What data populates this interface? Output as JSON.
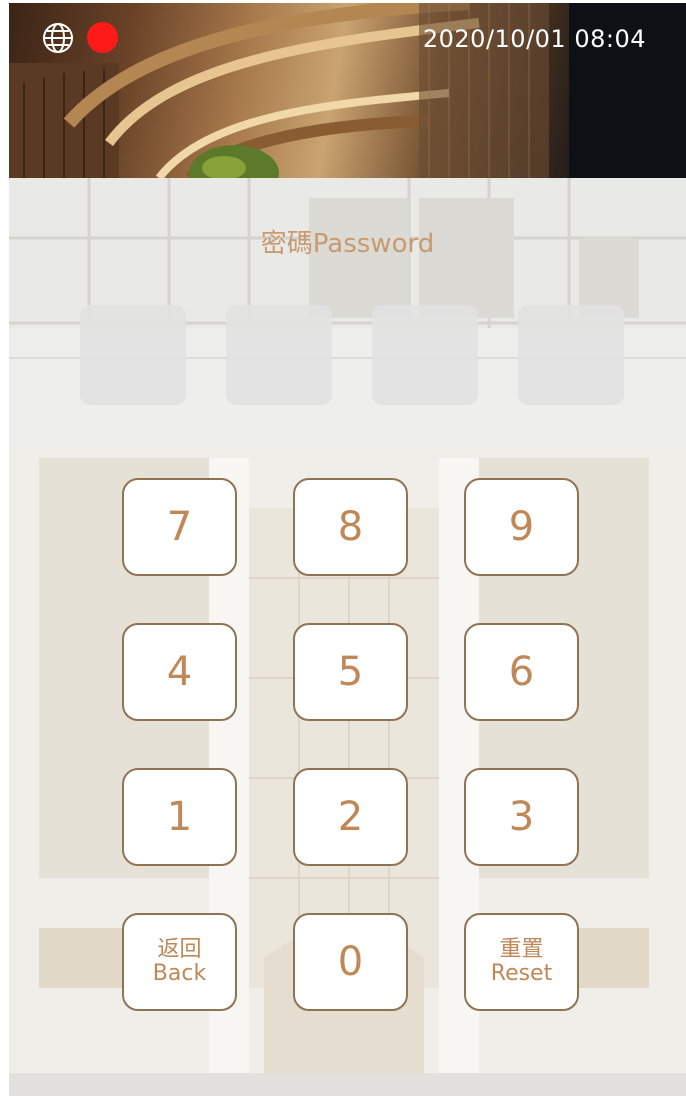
{
  "status": {
    "datetime": "2020/10/01  08:04",
    "network_icon": "globe-icon",
    "recording_color": "#ff1a1a"
  },
  "password": {
    "label": "密碼Password",
    "slots": [
      "",
      "",
      "",
      ""
    ]
  },
  "keypad": {
    "k7": "7",
    "k8": "8",
    "k9": "9",
    "k4": "4",
    "k5": "5",
    "k6": "6",
    "k1": "1",
    "k2": "2",
    "k3": "3",
    "k0": "0",
    "back_zh": "返回",
    "back_en": "Back",
    "reset_zh": "重置",
    "reset_en": "Reset"
  },
  "colors": {
    "accent": "#c08757",
    "key_border": "#8f7355",
    "slot_fill": "#e2e2e2"
  }
}
